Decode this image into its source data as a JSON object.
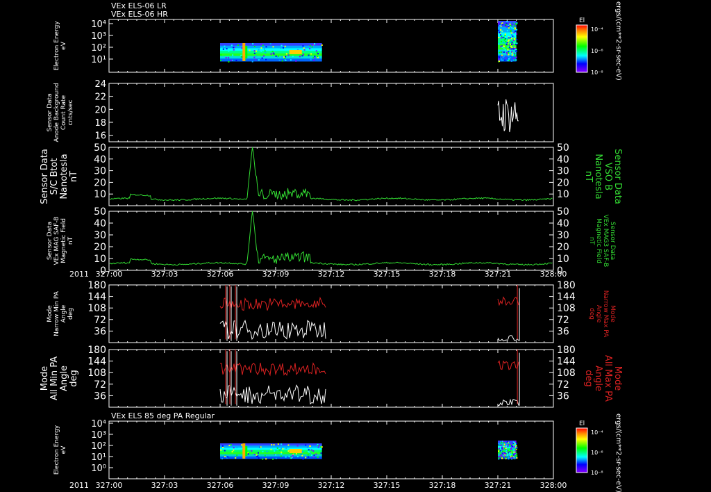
{
  "header": {
    "line1": "VEx ELS-06 LR",
    "line2": "VEx ELS-06 HR",
    "bottom_title": "VEx ELS 85 deg PA Regular",
    "year": "2011"
  },
  "colorbar": {
    "title": "El",
    "units": "ergs/(cm**2-sr-sec-eV)",
    "ticks": [
      "10⁻⁴",
      "10⁻⁶",
      "10⁻⁸"
    ]
  },
  "colors": {
    "background": "#000000",
    "axes": "#ffffff",
    "white_trace": "#ffffff",
    "green_trace": "#33dd33",
    "red_trace": "#dd2222"
  },
  "chart_data": {
    "type": "line",
    "x_ticks": [
      "327:00",
      "327:03",
      "327:06",
      "327:09",
      "327:12",
      "327:15",
      "327:18",
      "327:21",
      "328:00"
    ],
    "panels": [
      {
        "id": "energy_lr",
        "type": "heatmap",
        "left_label": [
          "Electron Energy",
          "eV"
        ],
        "y_scale": "log",
        "y_ticks": [
          "10⁴",
          "10³",
          "10²",
          "10¹"
        ],
        "data_windows": [
          {
            "x_start": "327:06",
            "x_end": "327:11:30"
          },
          {
            "x_start": "327:21:00",
            "x_end": "327:22:00"
          }
        ]
      },
      {
        "id": "background",
        "type": "line",
        "left_label": [
          "Sensor Data",
          "Anode Background",
          "Count Rate",
          "cnts/sec"
        ],
        "ylim": [
          15,
          24
        ],
        "y_ticks": [
          "24",
          "22",
          "20",
          "18",
          "16"
        ],
        "series": [
          {
            "color": "white",
            "x_start": "327:21:00",
            "x_end": "327:22:10",
            "range": [
              15.2,
              22.4
            ]
          }
        ]
      },
      {
        "id": "bmag_sc",
        "type": "line",
        "left_label": [
          "Sensor Data",
          "S/C Btot",
          "Nanotesla",
          "nT"
        ],
        "right_label": [
          "Sensor Data",
          "VSO B",
          "Nanotesla",
          "nT"
        ],
        "ylim": [
          0,
          50
        ],
        "y_ticks": [
          "50",
          "40",
          "30",
          "20",
          "10"
        ],
        "spike": {
          "x": "327:07:45",
          "value": 50
        },
        "baseline": 5
      },
      {
        "id": "bmag_mag3",
        "type": "line",
        "left_label": [
          "Sensor Data",
          "VEx MAG SAF-B",
          "Magnetic Field",
          "nT"
        ],
        "right_label": [
          "Sensor Data",
          "VEx MAG3 SAF-B",
          "Magnetic Field",
          "nT"
        ],
        "ylim": [
          0,
          50
        ],
        "y_ticks": [
          "50",
          "40",
          "30",
          "20",
          "10",
          "0"
        ],
        "spike": {
          "x": "327:07:45",
          "value": 50
        },
        "baseline": 5
      },
      {
        "id": "pa_narrow",
        "type": "line",
        "left_label": [
          "Mode",
          "Narrow Min PA",
          "Angle",
          "deg"
        ],
        "right_label": [
          "Mode",
          "Narrow Max PA",
          "Angle",
          "deg"
        ],
        "ylim": [
          0,
          180
        ],
        "y_ticks": [
          "180",
          "144",
          "108",
          "72",
          "36"
        ]
      },
      {
        "id": "pa_all",
        "type": "line",
        "left_label": [
          "Mode",
          "All Min PA",
          "Angle",
          "deg"
        ],
        "right_label": [
          "Mode",
          "All Max PA",
          "Angle",
          "deg"
        ],
        "ylim": [
          0,
          180
        ],
        "y_ticks": [
          "180",
          "144",
          "108",
          "72",
          "36"
        ]
      },
      {
        "id": "energy_85",
        "type": "heatmap",
        "left_label": [
          "Electron Energy",
          "eV"
        ],
        "y_scale": "log",
        "y_ticks": [
          "10⁴",
          "10³",
          "10²",
          "10¹",
          "10⁰"
        ],
        "data_windows": [
          {
            "x_start": "327:06",
            "x_end": "327:11:30"
          },
          {
            "x_start": "327:21:00",
            "x_end": "327:22:00"
          }
        ]
      }
    ]
  }
}
